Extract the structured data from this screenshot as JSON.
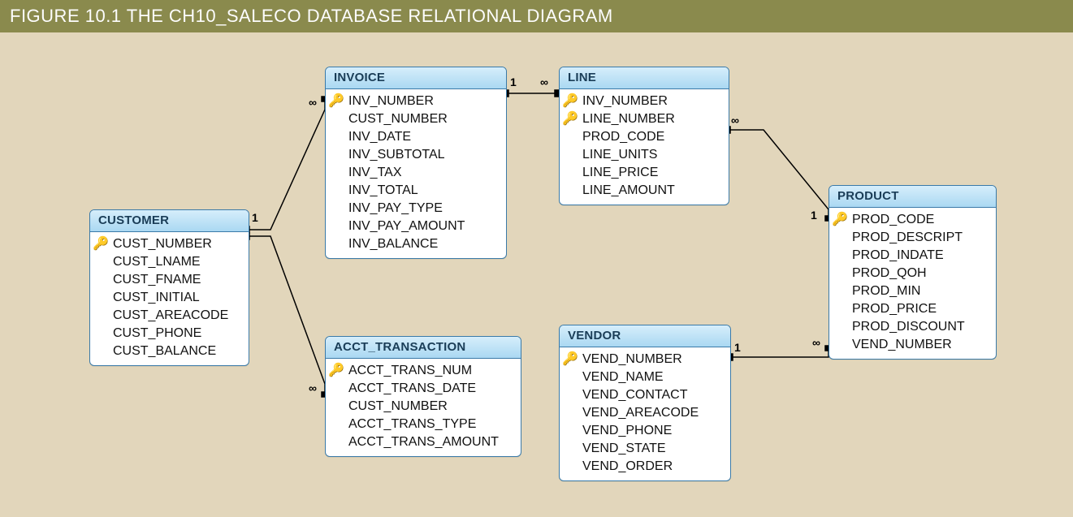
{
  "title": "FIGURE 10.1  THE CH10_SALECO DATABASE RELATIONAL DIAGRAM",
  "icons": {
    "key": "🔑"
  },
  "cardinality": {
    "one": "1",
    "many": "∞"
  },
  "entities": {
    "customer": {
      "name": "CUSTOMER",
      "attrs": [
        {
          "label": "CUST_NUMBER",
          "key": true
        },
        {
          "label": "CUST_LNAME"
        },
        {
          "label": "CUST_FNAME"
        },
        {
          "label": "CUST_INITIAL"
        },
        {
          "label": "CUST_AREACODE"
        },
        {
          "label": "CUST_PHONE"
        },
        {
          "label": "CUST_BALANCE"
        }
      ]
    },
    "invoice": {
      "name": "INVOICE",
      "attrs": [
        {
          "label": "INV_NUMBER",
          "key": true
        },
        {
          "label": "CUST_NUMBER"
        },
        {
          "label": "INV_DATE"
        },
        {
          "label": "INV_SUBTOTAL"
        },
        {
          "label": "INV_TAX"
        },
        {
          "label": "INV_TOTAL"
        },
        {
          "label": "INV_PAY_TYPE"
        },
        {
          "label": "INV_PAY_AMOUNT"
        },
        {
          "label": "INV_BALANCE"
        }
      ]
    },
    "line": {
      "name": "LINE",
      "attrs": [
        {
          "label": "INV_NUMBER",
          "key": true
        },
        {
          "label": "LINE_NUMBER",
          "key": true
        },
        {
          "label": "PROD_CODE"
        },
        {
          "label": "LINE_UNITS"
        },
        {
          "label": "LINE_PRICE"
        },
        {
          "label": "LINE_AMOUNT"
        }
      ]
    },
    "product": {
      "name": "PRODUCT",
      "attrs": [
        {
          "label": "PROD_CODE",
          "key": true
        },
        {
          "label": "PROD_DESCRIPT"
        },
        {
          "label": "PROD_INDATE"
        },
        {
          "label": "PROD_QOH"
        },
        {
          "label": "PROD_MIN"
        },
        {
          "label": "PROD_PRICE"
        },
        {
          "label": "PROD_DISCOUNT"
        },
        {
          "label": "VEND_NUMBER"
        }
      ]
    },
    "acct_transaction": {
      "name": "ACCT_TRANSACTION",
      "attrs": [
        {
          "label": "ACCT_TRANS_NUM",
          "key": true
        },
        {
          "label": "ACCT_TRANS_DATE"
        },
        {
          "label": "CUST_NUMBER"
        },
        {
          "label": "ACCT_TRANS_TYPE"
        },
        {
          "label": "ACCT_TRANS_AMOUNT"
        }
      ]
    },
    "vendor": {
      "name": "VENDOR",
      "attrs": [
        {
          "label": "VEND_NUMBER",
          "key": true
        },
        {
          "label": "VEND_NAME"
        },
        {
          "label": "VEND_CONTACT"
        },
        {
          "label": "VEND_AREACODE"
        },
        {
          "label": "VEND_PHONE"
        },
        {
          "label": "VEND_STATE"
        },
        {
          "label": "VEND_ORDER"
        }
      ]
    }
  },
  "relationships": [
    {
      "from": "customer",
      "to": "invoice",
      "from_card": "1",
      "to_card": "∞"
    },
    {
      "from": "customer",
      "to": "acct_transaction",
      "from_card": "1",
      "to_card": "∞"
    },
    {
      "from": "invoice",
      "to": "line",
      "from_card": "1",
      "to_card": "∞"
    },
    {
      "from": "line",
      "to": "product",
      "from_card": "∞",
      "to_card": "1"
    },
    {
      "from": "vendor",
      "to": "product",
      "from_card": "1",
      "to_card": "∞"
    }
  ]
}
